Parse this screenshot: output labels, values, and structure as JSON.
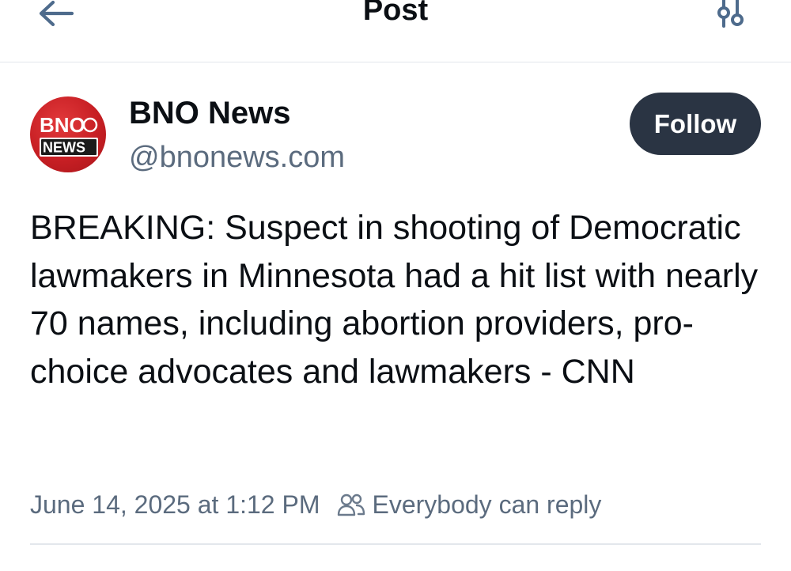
{
  "header": {
    "title": "Post",
    "back_icon": "arrow-left-icon",
    "filter_icon": "sliders-icon"
  },
  "author": {
    "name": "BNO News",
    "handle": "@bnonews.com",
    "avatar": {
      "text_top": "BNO",
      "text_bottom": "NEWS",
      "color": "#c71f24"
    },
    "follow_label": "Follow"
  },
  "post": {
    "text": "BREAKING: Suspect in shooting of Democratic lawmakers in Minnesota had a hit list with nearly 70 names, including abortion providers, pro-choice advocates and lawmakers - CNN",
    "timestamp": "June 14, 2025 at 1:12 PM",
    "reply_setting": "Everybody can reply",
    "reply_icon": "people-icon"
  },
  "colors": {
    "text": "#0b0f14",
    "muted": "#5b6b7e",
    "button_bg": "#2a3443",
    "icon": "#4e6b8c",
    "divider": "#e3e7ec"
  }
}
